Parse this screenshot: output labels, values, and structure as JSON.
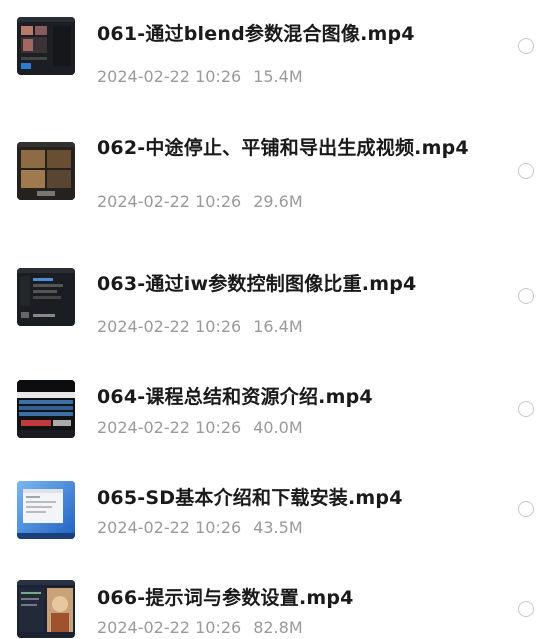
{
  "files": [
    {
      "name": "061-通过blend参数混合图像.mp4",
      "date": "2024-02-22 10:26",
      "size": "15.4M",
      "thumb": "video-thumbnail-dark-ui",
      "selected": false
    },
    {
      "name": "062-中途停止、平铺和导出生成视频.mp4",
      "date": "2024-02-22 10:26",
      "size": "29.6M",
      "thumb": "video-thumbnail-image-grid",
      "selected": false
    },
    {
      "name": "063-通过iw参数控制图像比重.mp4",
      "date": "2024-02-22 10:26",
      "size": "16.4M",
      "thumb": "video-thumbnail-dark-ui",
      "selected": false
    },
    {
      "name": "064-课程总结和资源介绍.mp4",
      "date": "2024-02-22 10:26",
      "size": "40.0M",
      "thumb": "video-thumbnail-slides",
      "selected": false
    },
    {
      "name": "065-SD基本介绍和下载安装.mp4",
      "date": "2024-02-22 10:26",
      "size": "43.5M",
      "thumb": "video-thumbnail-windows-desktop",
      "selected": false
    },
    {
      "name": "066-提示词与参数设置.mp4",
      "date": "2024-02-22 10:26",
      "size": "82.8M",
      "thumb": "video-thumbnail-portrait",
      "selected": false
    }
  ]
}
